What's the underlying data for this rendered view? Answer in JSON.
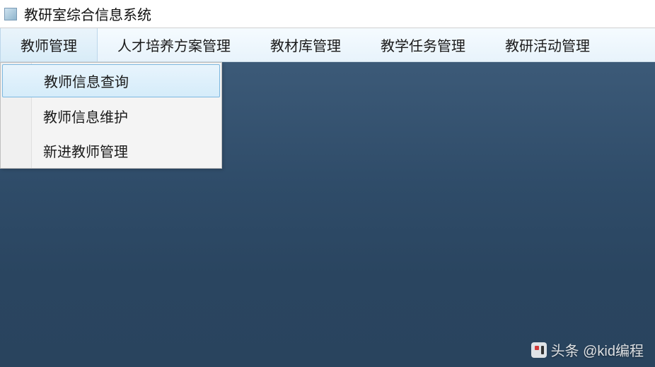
{
  "window": {
    "title": "教研室综合信息系统"
  },
  "menubar": {
    "items": [
      {
        "label": "教师管理",
        "active": true
      },
      {
        "label": "人才培养方案管理",
        "active": false
      },
      {
        "label": "教材库管理",
        "active": false
      },
      {
        "label": "教学任务管理",
        "active": false
      },
      {
        "label": "教研活动管理",
        "active": false
      }
    ]
  },
  "dropdown": {
    "items": [
      {
        "label": "教师信息查询",
        "highlight": true
      },
      {
        "label": "教师信息维护",
        "highlight": false
      },
      {
        "label": "新进教师管理",
        "highlight": false
      }
    ]
  },
  "watermark": {
    "text": "头条 @kid编程"
  }
}
